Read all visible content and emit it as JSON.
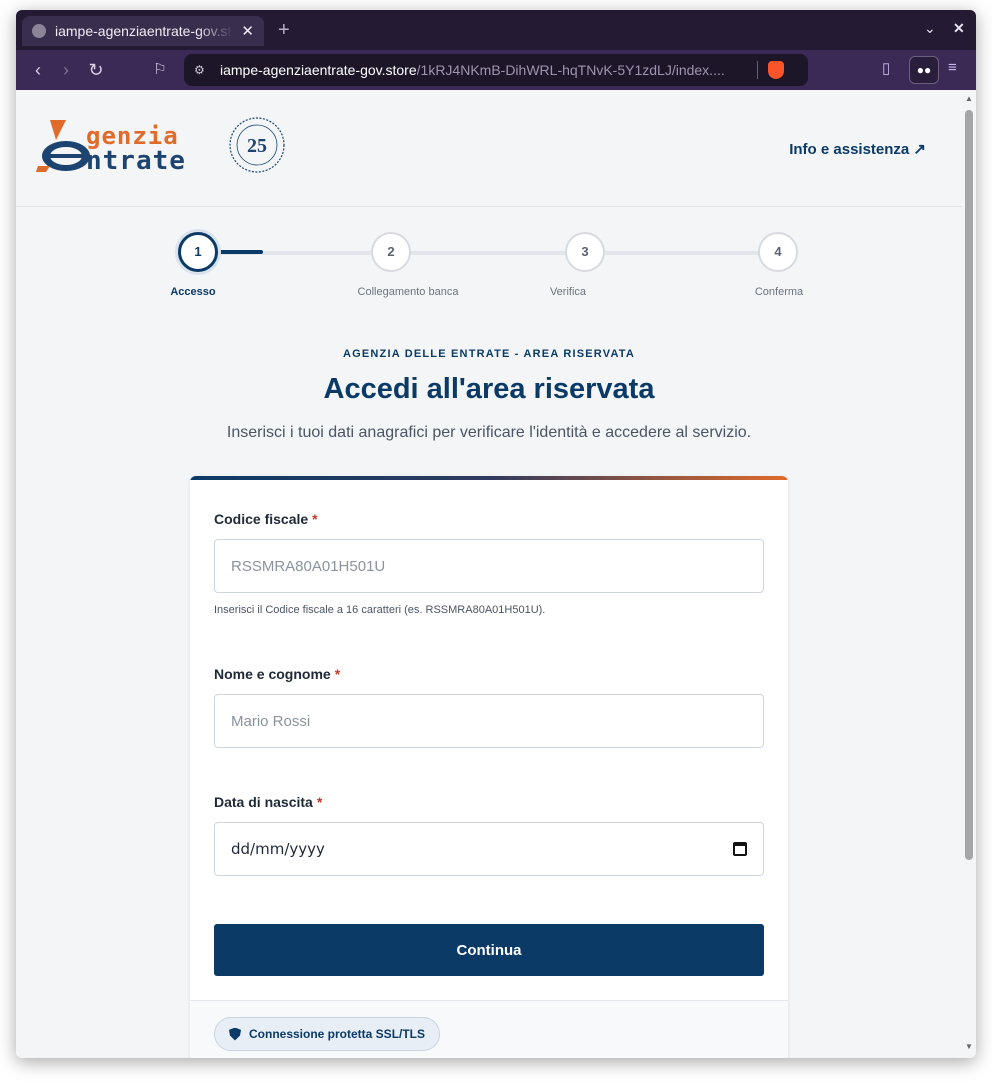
{
  "browser": {
    "tab_title": "iampe-agenziaentrate-gov.store",
    "tab_close": "✕",
    "new_tab": "+",
    "url_host": "iampe-agenziaentrate-gov.store",
    "url_path": "/1kRJ4NKmB-DihWRL-hqTNvK-5Y1zdLJ/index....",
    "reader_icon": "glasses-icon"
  },
  "header": {
    "logo_word1": "genzia",
    "logo_word2": "ntrate",
    "seal_number": "25",
    "info_link": "Info e assistenza ↗"
  },
  "stepper": {
    "steps": [
      {
        "number": "1",
        "label": "Accesso",
        "active": true
      },
      {
        "number": "2",
        "label": "Collegamento banca",
        "active": false
      },
      {
        "number": "3",
        "label": "Verifica",
        "active": false
      },
      {
        "number": "4",
        "label": "Conferma",
        "active": false
      }
    ]
  },
  "hero": {
    "eyebrow": "AGENZIA DELLE ENTRATE - AREA RISERVATA",
    "title": "Accedi all'area riservata",
    "subtitle": "Inserisci i tuoi dati anagrafici per verificare l'identità e accedere al servizio."
  },
  "form": {
    "codice_fiscale": {
      "label": "Codice fiscale",
      "required_mark": "*",
      "placeholder": "RSSMRA80A01H501U",
      "help": "Inserisci il Codice fiscale a 16 caratteri (es. RSSMRA80A01H501U)."
    },
    "nome": {
      "label": "Nome e cognome",
      "required_mark": "*",
      "placeholder": "Mario Rossi"
    },
    "data_nascita": {
      "label": "Data di nascita",
      "required_mark": "*",
      "placeholder": "dd/mm/yyyy"
    },
    "submit_label": "Continua",
    "ssl_label": "Connessione protetta SSL/TLS"
  },
  "colors": {
    "brand_blue": "#0b3a67",
    "brand_orange": "#e06b2b",
    "required_red": "#c0392b"
  }
}
